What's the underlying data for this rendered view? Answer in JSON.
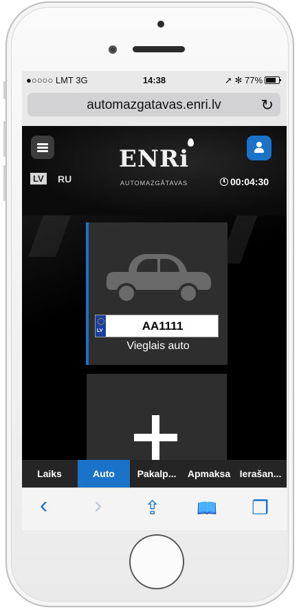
{
  "status": {
    "carrier": "●○○○○ LMT  3G",
    "time": "14:38",
    "battery": "➚ ✻ 77%"
  },
  "browser": {
    "url": "automazgatavas.enri.lv",
    "reload_icon": "↻"
  },
  "header": {
    "lang_active": "LV",
    "lang_other": "RU",
    "logo_text": "ENRi",
    "logo_sub": "AUTOMAZGĀTAVAS",
    "timer": "00:04:30"
  },
  "car": {
    "plate_country": "LV",
    "plate": "AA1111",
    "type": "Vieglais auto"
  },
  "tabs": [
    "Laiks",
    "Auto",
    "Pakalp...",
    "Apmaksa",
    "Ierašan..."
  ],
  "toolbar": {
    "back": "‹",
    "forward": "›",
    "share": "⇪",
    "bookmarks": "📖",
    "tabs": "❐"
  },
  "colors": {
    "accent": "#1a73c8",
    "card": "#2e2e2e",
    "tabbar": "#252525"
  }
}
